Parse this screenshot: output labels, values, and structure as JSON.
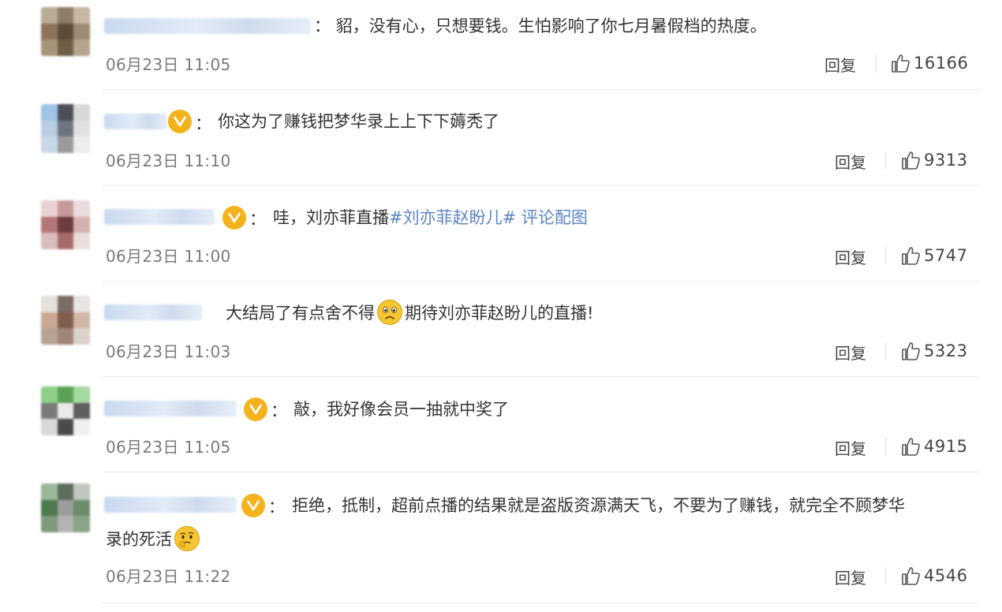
{
  "comments": [
    {
      "text_before": "：  貂，没有心，只想要钱。生怕影响了你七月暑假档的热度。",
      "topic": "",
      "text_after": "",
      "text_line2": "",
      "verified": false,
      "time": "06月23日 11:05",
      "reply_label": "回复",
      "likes": "16166"
    },
    {
      "text_before": "你这为了赚钱把梦华录上上下下薅秃了",
      "topic": "",
      "text_after": "",
      "text_line2": "",
      "verified": true,
      "time": "06月23日 11:10",
      "reply_label": "回复",
      "likes": "9313"
    },
    {
      "text_before": "哇，刘亦菲直播",
      "topic": "#刘亦菲赵盼儿# 评论配图",
      "text_after": "",
      "text_line2": "",
      "verified": true,
      "time": "06月23日 11:00",
      "reply_label": "回复",
      "likes": "5747"
    },
    {
      "text_before": "大结局了有点舍不得",
      "topic": "",
      "text_after": "期待刘亦菲赵盼儿的直播!",
      "text_line2": "",
      "verified": false,
      "time": "06月23日 11:03",
      "reply_label": "回复",
      "likes": "5323"
    },
    {
      "text_before": "敲，我好像会员一抽就中奖了",
      "topic": "",
      "text_after": "",
      "text_line2": "",
      "verified": true,
      "time": "06月23日 11:05",
      "reply_label": "回复",
      "likes": "4915"
    },
    {
      "text_before": "拒绝，抵制，超前点播的结果就是盗版资源满天飞，不要为了赚钱，就完全不顾梦华",
      "topic": "",
      "text_after": "",
      "text_line2": "录的死活",
      "verified": true,
      "time": "06月23日 11:22",
      "reply_label": "回复",
      "likes": "4546"
    }
  ],
  "colon": "：",
  "colors": {
    "text": "#333333",
    "topic_link": "#5b84c6",
    "time": "#7a7a7a",
    "verified_badge": "#f5b21b"
  },
  "icons": {
    "verified": "verified-v-icon",
    "like": "thumbs-up-icon",
    "sad_emoji": "sad-face-emoji-icon",
    "thinking_emoji": "thinking-face-emoji-icon"
  }
}
